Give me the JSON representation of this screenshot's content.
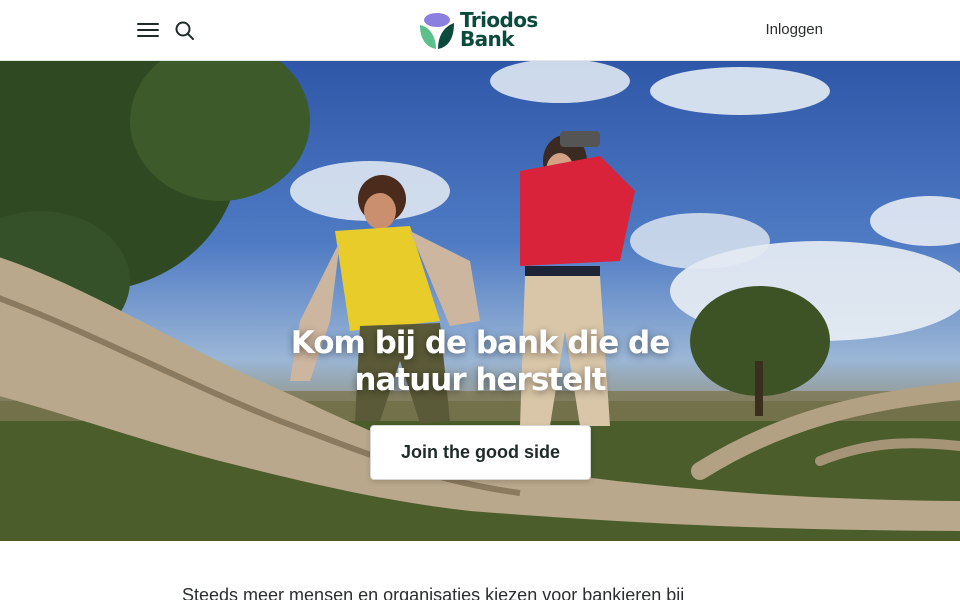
{
  "header": {
    "logo_line1": "Triodos",
    "logo_line2": "Bank",
    "login_label": "Inloggen",
    "menu_icon": "hamburger-icon",
    "search_icon": "search-icon"
  },
  "hero": {
    "title": "Kom bij de bank die de natuur herstelt",
    "cta_label": "Join the good side"
  },
  "intro": {
    "text": "Steeds meer mensen en organisaties kiezen voor bankieren bij"
  },
  "colors": {
    "brand_green": "#0a4b3d",
    "logo_purple": "#8b7fe0",
    "logo_green": "#2faa6b"
  }
}
